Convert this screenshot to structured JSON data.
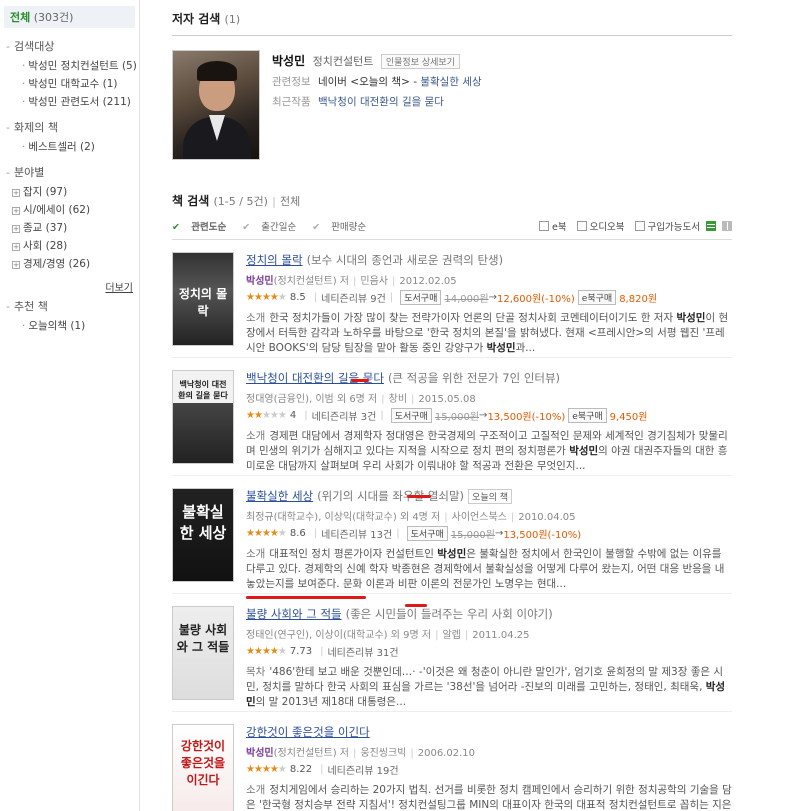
{
  "sidebar": {
    "all_label": "전체",
    "all_count": "(303건)",
    "sections": [
      {
        "title": "검색대상",
        "marker": "-",
        "items": [
          {
            "label": "박성민 정치컨설턴트 (5)"
          },
          {
            "label": "박성민 대학교수 (1)"
          },
          {
            "label": "박성민 관련도서 (211)"
          }
        ]
      },
      {
        "title": "화제의 책",
        "marker": "-",
        "items": [
          {
            "label": "베스트셀러 (2)"
          }
        ]
      },
      {
        "title": "분야별",
        "marker": "-",
        "boxed": true,
        "items": [
          {
            "label": "잡지 (97)"
          },
          {
            "label": "시/에세이 (62)"
          },
          {
            "label": "종교 (37)"
          },
          {
            "label": "사회 (28)"
          },
          {
            "label": "경제/경영 (26)"
          }
        ]
      }
    ],
    "more_label": "더보기",
    "recommend": {
      "title": "추천 책",
      "marker": "-",
      "items": [
        {
          "label": "오늘의책 (1)"
        }
      ]
    }
  },
  "author_section": {
    "title": "저자 검색",
    "count": "(1)",
    "name": "박성민",
    "role": "정치컨설턴트",
    "detail_button": "인물정보 상세보기",
    "related_key": "관련정보",
    "related_value_a": "네이버 <오늘의 책> - ",
    "related_value_b": "불확실한 세상",
    "recent_key": "최근작품",
    "recent_value": "백낙청이 대전환의 길을 묻다"
  },
  "books_section": {
    "title": "책 검색",
    "count": "(1-5 / 5건)",
    "all_link": "전체",
    "sorts": [
      {
        "label": "관련도순",
        "active": true
      },
      {
        "label": "출간일순",
        "active": false
      },
      {
        "label": "판매량순",
        "active": false
      }
    ],
    "options": [
      "e북",
      "오디오북",
      "구입가능도서"
    ]
  },
  "books": [
    {
      "title": "정치의 몰락",
      "subtitle": "(보수 시대의 종언과 새로운 권력의 탄생)",
      "tag": "",
      "meta": [
        {
          "text": "박성민",
          "hl": true
        },
        {
          "text": "(정치컨설턴트) 저"
        },
        {
          "text": "민음사"
        },
        {
          "text": "2012.02.05"
        }
      ],
      "stars": 4,
      "score": "8.5",
      "reviews": "네티즌리뷰 9건",
      "buy_button": "도서구매",
      "orig_price": "14,000원",
      "arrow": "→",
      "sale_price": "12,600원(-10%)",
      "ebook_button": "e북구매",
      "ebook_price": "8,820원",
      "desc_label": "소개",
      "desc": "한국 정치가들이 가장 많이 찾는 전략가이자 언론의 단골 정치사회 코멘테이터이기도 한 저자 박성민이 현장에서 터득한 감각과 노하우를 바탕으로 '한국 정치의 본질'을 밝혀냈다. 현재 <프레시안>의 서평 웹진 '프레시안 BOOKS'의 담당 팀장을 맡아 활동 중인 강양구가 박성민과...",
      "cover_text": "정치의 몰락"
    },
    {
      "title": "백낙청이 대전환의 길을 묻다",
      "subtitle": "(큰 적공을 위한 전문가 7인 인터뷰)",
      "tag": "",
      "meta": [
        {
          "text": "정대영(금융인), 이범 외 6명 저"
        },
        {
          "text": "창비"
        },
        {
          "text": "2015.05.08"
        }
      ],
      "stars": 2,
      "score": "4",
      "reviews": "네티즌리뷰 3건",
      "buy_button": "도서구매",
      "orig_price": "15,000원",
      "arrow": "→",
      "sale_price": "13,500원(-10%)",
      "ebook_button": "e북구매",
      "ebook_price": "9,450원",
      "desc_label": "소개",
      "desc": "경제편 대담에서 경제학자 정대영은 한국경제의 구조적이고 고질적인 문제와 세계적인 경기침체가 맞물리며 민생의 위기가 심해지고 있다는 지적을 시작으로 정치 편의 정치평론가 박성민의 야권 대권주자들의 대한 흥미로운 대담까지 살펴보며 우리 사회가 이뤄내야 할 적공과 전환은 무엇인지...",
      "cover_text": "백낙청이 대전환의 길을 묻다"
    },
    {
      "title": "불확실한 세상",
      "subtitle": "(위기의 시대를 좌우할 열쇠말)",
      "tag": "오늘의 책",
      "meta": [
        {
          "text": "최정규(대학교수), 이상익(대학교수) 외 4명 저"
        },
        {
          "text": "사이언스북스"
        },
        {
          "text": "2010.04.05"
        }
      ],
      "stars": 4,
      "score": "8.6",
      "reviews": "네티즌리뷰 13건",
      "buy_button": "도서구매",
      "orig_price": "15,000원",
      "arrow": "→",
      "sale_price": "13,500원(-10%)",
      "ebook_button": "",
      "ebook_price": "",
      "desc_label": "소개",
      "desc": "대표적인 정치 평론가이자 컨설턴트인 박성민은 불확실한 정치에서 한국인이 불행할 수밖에 없는 이유를 다루고 있다. 경제학의 신예 학자 박종현은 경제학에서 불확실성을 어떻게 다루어 왔는지, 어떤 대응 반응을 내놓았는지를 보여준다. 문화 이론과 비판 이론의 전문가인 노명우는 현대...",
      "cover_text": "불확실한 세상"
    },
    {
      "title": "불량 사회와 그 적들",
      "subtitle": "(좋은 시민들이 들려주는 우리 사회 이야기)",
      "tag": "",
      "meta": [
        {
          "text": "정태인(연구인), 이상이(대학교수) 외 9명 저"
        },
        {
          "text": "알렙"
        },
        {
          "text": "2011.04.25"
        }
      ],
      "stars": 4,
      "score": "7.73",
      "reviews": "네티즌리뷰 31건",
      "buy_button": "",
      "orig_price": "",
      "arrow": "",
      "sale_price": "",
      "ebook_button": "",
      "ebook_price": "",
      "desc_label": "목차",
      "desc": "'486'한테 보고 배운 것뿐인데…· -'이것은 왜 청춘이 아니란 말인가', 엄기호 윤희정의 말 제3장 좋은 시민, 정치를 말하다 한국 사회의 표심을 가르는 '38선'을 넘어라 -진보의 미래를 고민하는, 정태인, 최태욱, 박성민의 말 2013년 제18대 대통령은...",
      "cover_text": "불량 사회와 그 적들"
    },
    {
      "title": "강한것이 좋은것을 이긴다",
      "subtitle": "",
      "tag": "",
      "meta": [
        {
          "text": "박성민",
          "hl": true
        },
        {
          "text": "(정치컨설턴트) 저"
        },
        {
          "text": "웅진씽크빅"
        },
        {
          "text": "2006.02.10"
        }
      ],
      "stars": 4,
      "score": "8.22",
      "reviews": "네티즌리뷰 19건",
      "buy_button": "",
      "orig_price": "",
      "arrow": "",
      "sale_price": "",
      "ebook_button": "",
      "ebook_price": "",
      "desc_label": "소개",
      "desc": "정치게임에서 승리하는 20가지 법칙. 선거를 비롯한 정치 캠페인에서 승리하기 위한 정치공학의 기술을 담은 '한국형 정치승부 전략 지침서'! 정치컨설팅그룹 MIN의 대표이자 한국의 대표적 정치컨설턴트로 꼽히는 지은이가 정치 승부를 승리로 이끌었던 사례들을 날날이 분석한 뒤...",
      "cover_text": "강한것이 좋은것을 이긴다"
    }
  ]
}
